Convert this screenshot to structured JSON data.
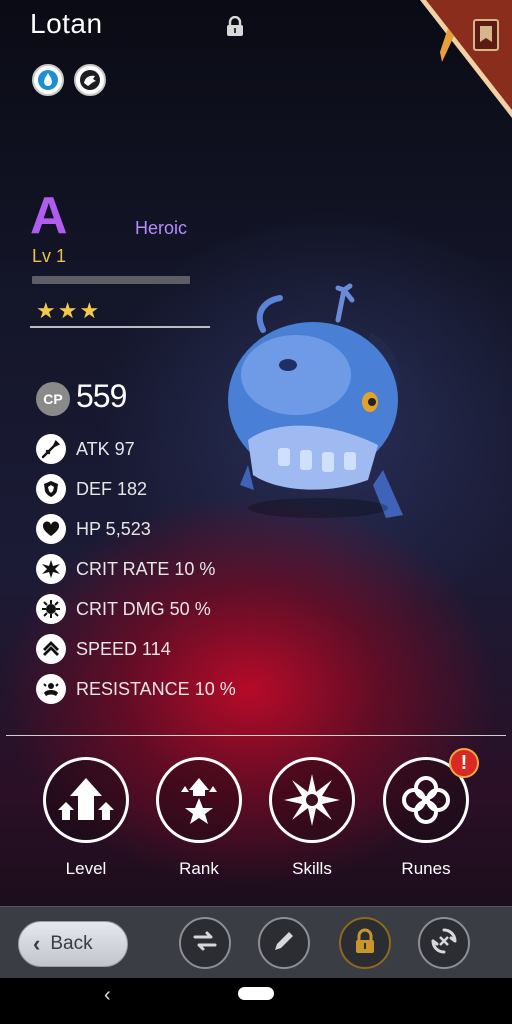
{
  "header": {
    "monster_name": "Lotan",
    "element_icons": [
      "water-drop-icon",
      "creature-type-icon"
    ]
  },
  "profile": {
    "grade_letter": "A",
    "rarity": "Heroic",
    "level": "Lv 1",
    "xp_progress": 0,
    "stars": "★★★",
    "star_count": 3
  },
  "cp": {
    "badge": "CP",
    "value": "559"
  },
  "stats": [
    {
      "icon": "sword-icon",
      "label": "ATK 97"
    },
    {
      "icon": "shield-icon",
      "label": "DEF 182"
    },
    {
      "icon": "heart-icon",
      "label": "HP 5,523"
    },
    {
      "icon": "crit-rate-icon",
      "label": "CRIT RATE 10 %"
    },
    {
      "icon": "crit-dmg-icon",
      "label": "CRIT DMG 50 %"
    },
    {
      "icon": "speed-icon",
      "label": "SPEED 114"
    },
    {
      "icon": "resistance-icon",
      "label": "RESISTANCE 10 %"
    }
  ],
  "actions": [
    {
      "icon": "level-up-arrows-icon",
      "label": "Level"
    },
    {
      "icon": "rank-star-icon",
      "label": "Rank"
    },
    {
      "icon": "skills-burst-icon",
      "label": "Skills"
    },
    {
      "icon": "runes-knot-icon",
      "label": "Runes"
    }
  ],
  "runes_alert": "!",
  "bottom_bar": {
    "back_label": "Back",
    "tools": [
      "swap-icon",
      "edit-pencil-icon",
      "lock-icon",
      "recycle-icon"
    ]
  },
  "colors": {
    "grade": "#b05cf0",
    "rarity": "#b78cff",
    "level": "#e8c24a",
    "stars": "#f2c94c",
    "alert": "#d82a22"
  }
}
